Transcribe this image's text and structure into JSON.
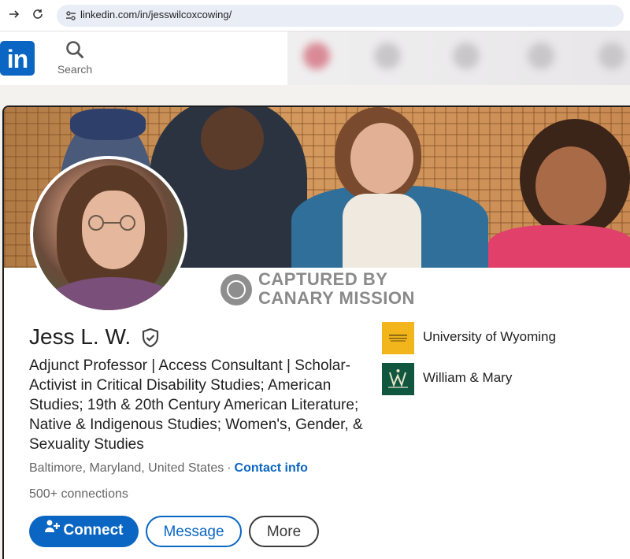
{
  "browser": {
    "url": "linkedin.com/in/jesswilcoxcowing/",
    "back_icon": "arrow-right-icon",
    "reload_icon": "reload-icon"
  },
  "header": {
    "logo": "in",
    "search_label": "Search"
  },
  "watermark": {
    "line1": "CAPTURED BY",
    "line2": "CANARY MISSION"
  },
  "profile": {
    "name": "Jess L. W.",
    "headline": "Adjunct Professor | Access Consultant | Scholar-Activist in Critical Disability Studies; American Studies; 19th & 20th Century American Literature; Native & Indigenous Studies; Women's, Gender, & Sexuality Studies",
    "location": "Baltimore, Maryland, United States",
    "separator": "·",
    "contact_label": "Contact info",
    "connections": "500+ connections"
  },
  "actions": {
    "connect_label": "Connect",
    "message_label": "Message",
    "more_label": "More"
  },
  "education": [
    {
      "name": "University of Wyoming",
      "logo_color": "#f2b61c"
    },
    {
      "name": "William & Mary",
      "logo_color": "#115740"
    }
  ],
  "colors": {
    "accent": "#0a66c2",
    "watermark": "#8a8a8a"
  }
}
